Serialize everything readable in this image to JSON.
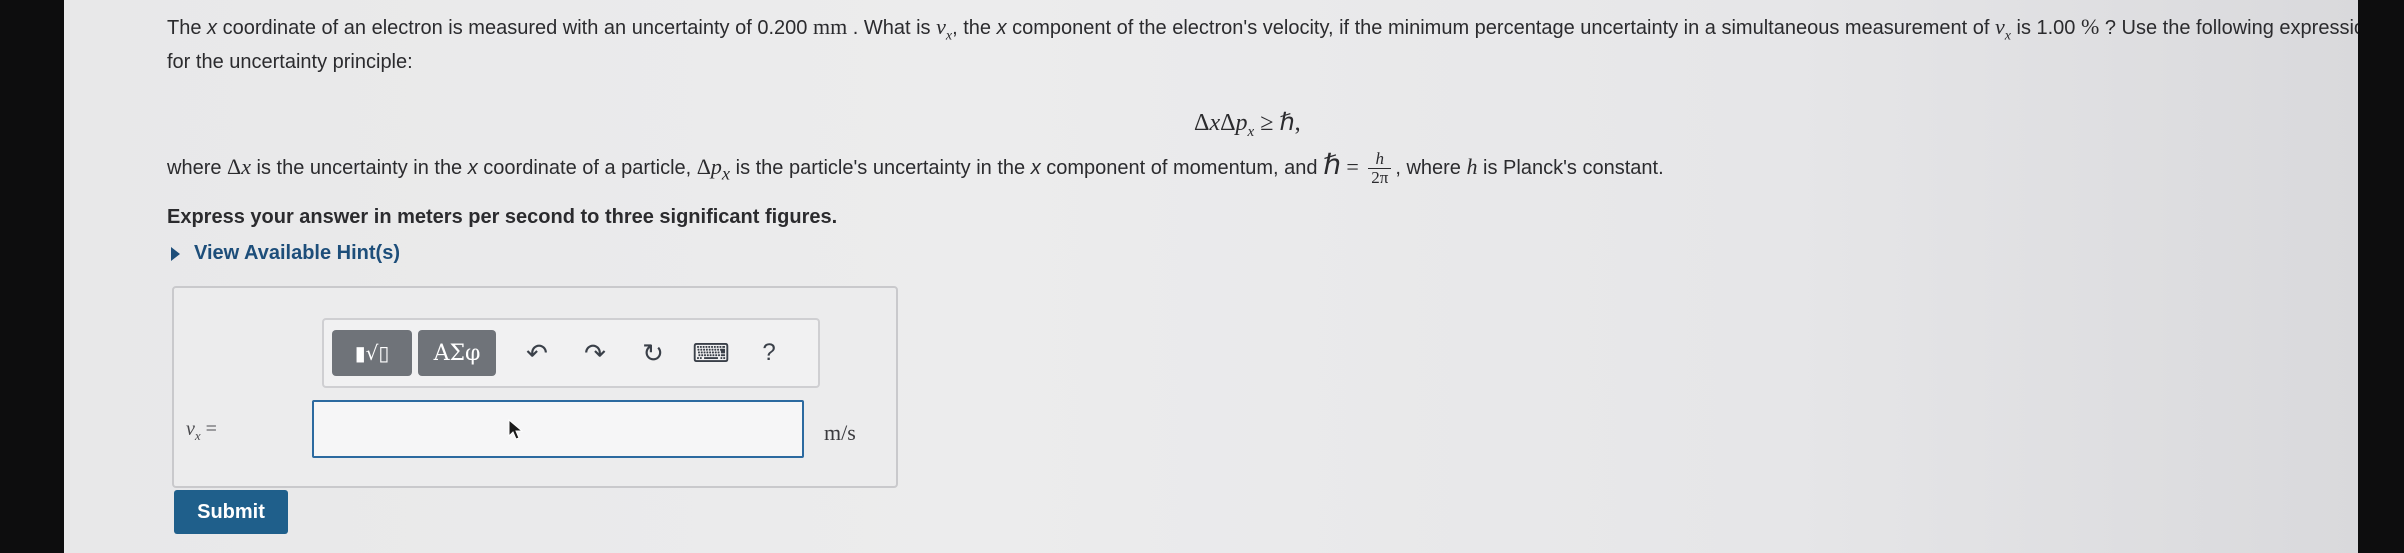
{
  "question": {
    "p1_a": "The ",
    "p1_x1": "x",
    "p1_b": " coordinate of an electron is measured with an uncertainty of 0.200 ",
    "p1_mm": "mm",
    "p1_c": " . What is ",
    "p1_v": "v",
    "p1_vsub": "x",
    "p1_d": ", the ",
    "p1_x2": "x",
    "p1_e": " component of the electron's velocity, if the minimum percentage uncertainty in a simultaneous measurement of ",
    "p1_v2": "v",
    "p1_v2sub": "x",
    "p1_f": " is 1.00 ",
    "p1_pct": "%",
    "p1_g": " ? Use the following expression for the uncertainty principle:"
  },
  "equation": {
    "d1": "Δ",
    "x": "x",
    "d2": "Δ",
    "p": "p",
    "psub": "x",
    "rel": " ≥ ",
    "hbar": "ℏ",
    "comma": ","
  },
  "where": {
    "a": "where ",
    "dx_d": "Δ",
    "dx_x": "x",
    "b": " is the uncertainty in the ",
    "x1": "x",
    "c": " coordinate of a particle, ",
    "dp_d": "Δ",
    "dp_p": "p",
    "dp_sub": "x",
    "d": " is the particle's uncertainty in the ",
    "x2": "x",
    "e": " component of momentum, and ",
    "hbar": "ℏ",
    "eq": " = ",
    "frac_num": "h",
    "frac_den": "2π",
    "f": ", where ",
    "h": "h",
    "g": " is Planck's constant."
  },
  "instruction": "Express your answer in meters per second to three significant figures.",
  "hint_label": "View Available Hint(s)",
  "toolbar": {
    "templates_label": "▮√▯",
    "symbols_label": "ΑΣφ",
    "undo": "↶",
    "redo": "↷",
    "reset": "↻",
    "keyboard": "⌨",
    "help": "?"
  },
  "answer": {
    "var": "v",
    "var_sub": "x",
    "equals": " =",
    "value": "",
    "unit": "m/s"
  },
  "submit_label": "Submit"
}
